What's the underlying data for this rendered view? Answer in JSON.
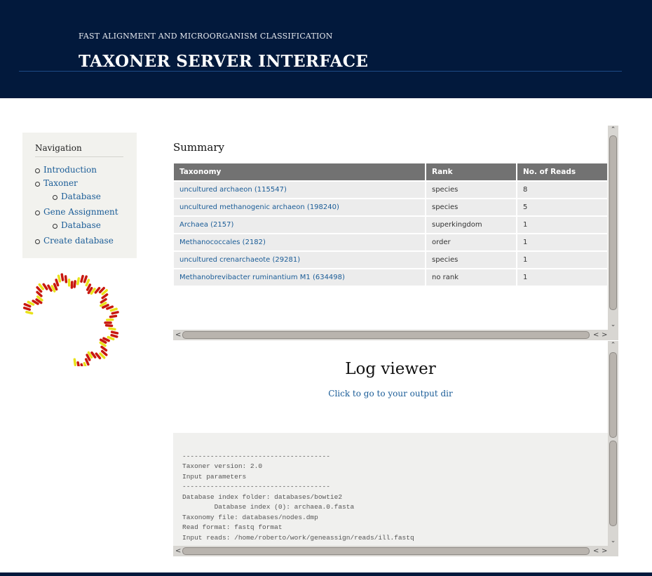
{
  "header": {
    "subtitle": "FAST ALIGNMENT AND MICROORGANISM CLASSIFICATION",
    "title": "TAXONER SERVER INTERFACE"
  },
  "nav": {
    "title": "Navigation",
    "items": [
      {
        "label": "Introduction"
      },
      {
        "label": "Taxoner",
        "children": [
          {
            "label": "Database"
          }
        ]
      },
      {
        "label": "Gene Assignment",
        "children": [
          {
            "label": "Database"
          }
        ]
      },
      {
        "label": "Create database"
      }
    ]
  },
  "summary": {
    "title": "Summary",
    "columns": [
      "Taxonomy",
      "Rank",
      "No. of Reads"
    ],
    "rows": [
      [
        "uncultured archaeon (115547)",
        "species",
        "8"
      ],
      [
        "uncultured methanogenic archaeon (198240)",
        "species",
        "5"
      ],
      [
        "Archaea (2157)",
        "superkingdom",
        "1"
      ],
      [
        "Methanococcales (2182)",
        "order",
        "1"
      ],
      [
        "uncultured crenarchaeote (29281)",
        "species",
        "1"
      ],
      [
        "Methanobrevibacter ruminantium M1 (634498)",
        "no rank",
        "1"
      ]
    ]
  },
  "log": {
    "title": "Log viewer",
    "link": "Click to go to your output dir",
    "lines": [
      "-------------------------------------",
      "Taxoner version: 2.0",
      "",
      "Input parameters",
      "-------------------------------------",
      "Database index folder: databases/bowtie2",
      "        Database index (0): archaea.0.fasta",
      "Taxonomy file: databases/nodes.dmp",
      "Read format: fastq format",
      "Input reads: /home/roberto/work/geneassign/reads/ill.fastq"
    ]
  },
  "colors": {
    "header_bg": "#02193c",
    "link": "#1a5c97",
    "table_header_bg": "#727272",
    "table_cell_bg": "#ececec"
  }
}
